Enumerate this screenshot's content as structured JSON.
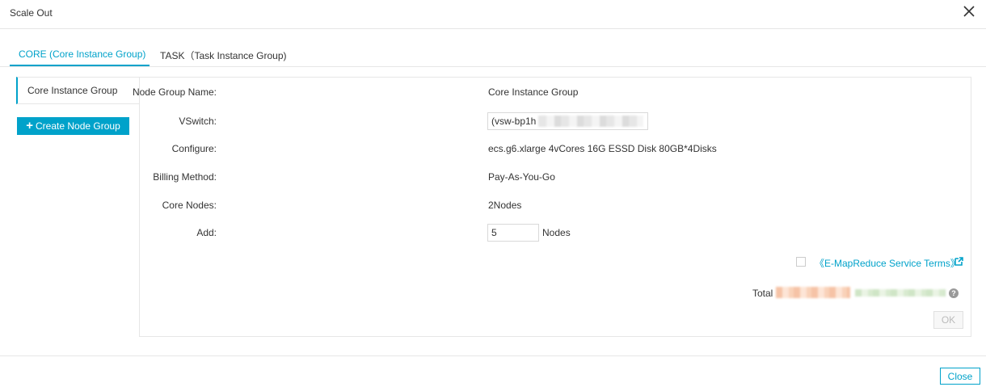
{
  "dialog": {
    "title": "Scale Out"
  },
  "tabs": [
    {
      "label": "CORE (Core Instance Group)",
      "active": true
    },
    {
      "label": "TASK（Task Instance Group)",
      "active": false
    }
  ],
  "sidebar": {
    "items": [
      {
        "label": "Core Instance Group"
      }
    ],
    "create_button": "Create Node Group"
  },
  "form": {
    "node_group_name": {
      "label": "Node Group Name:",
      "value": "Core Instance Group"
    },
    "vswitch": {
      "label": "VSwitch:",
      "value": "(vsw-bp1h"
    },
    "configure": {
      "label": "Configure:",
      "value": "ecs.g6.xlarge 4vCores 16G ESSD Disk 80GB*4Disks"
    },
    "billing_method": {
      "label": "Billing Method:",
      "value": "Pay-As-You-Go"
    },
    "core_nodes": {
      "label": "Core Nodes:",
      "value": "2Nodes"
    },
    "add": {
      "label": "Add:",
      "value": "5",
      "unit": "Nodes"
    }
  },
  "terms": {
    "link": "《E-MapReduce Service Terms》",
    "checked": false
  },
  "total": {
    "label": "Total"
  },
  "buttons": {
    "ok": "OK",
    "close": "Close"
  },
  "colors": {
    "accent": "#00a2ca",
    "border": "#e6e6e6"
  },
  "icons": {
    "close": "close-icon",
    "plus": "plus-icon",
    "external_link": "external-link-icon",
    "help": "help-icon"
  }
}
